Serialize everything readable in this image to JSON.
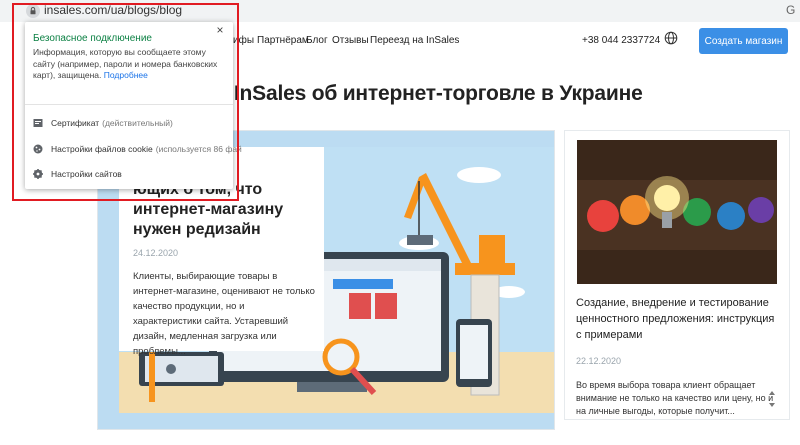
{
  "browser": {
    "url": "insales.com/ua/blogs/blog"
  },
  "header": {
    "nav": [
      "ифы",
      "Партнёрам",
      "Блог",
      "Отзывы",
      "Переезд на InSales"
    ],
    "phone": "+38 044 2337724",
    "cta": "Создать магазин"
  },
  "page": {
    "heading": "юг InSales об интернет-торговле в Украине"
  },
  "hero": {
    "title": "ющих о том, что интернет-магазину нужен редизайн",
    "date": "24.12.2020",
    "excerpt": "Клиенты, выбирающие товары в интернет-магазине, оценивают не только качество продукции, но и характеристики сайта. Устаревший дизайн, медленная загрузка или проблемы..."
  },
  "card2": {
    "title": "Создание, внедрение и тестирование ценностного предложения: инструкция с примерами",
    "date": "22.12.2020",
    "excerpt": "Во время выбора товара клиент обращает внимание не только на качество или цену, но и на личные выгоды, которые получит..."
  },
  "popup": {
    "title": "Безопасное подключение",
    "description": "Информация, которую вы сообщаете этому сайту (например, пароли и номера банковских карт), защищена.",
    "more_link": "Подробнее",
    "items": [
      {
        "label": "Сертификат",
        "detail": "(действительный)",
        "icon": "certificate-icon"
      },
      {
        "label": "Настройки файлов cookie",
        "detail": "(используется 86 фай",
        "icon": "cookie-icon"
      },
      {
        "label": "Настройки сайтов",
        "detail": "",
        "icon": "gear-icon"
      }
    ],
    "close": "×"
  },
  "colors": {
    "accent": "#3b8fe6",
    "secure_green": "#0b8043",
    "highlight_red": "#e11b22",
    "hero_bg": "#bcdcf2"
  }
}
